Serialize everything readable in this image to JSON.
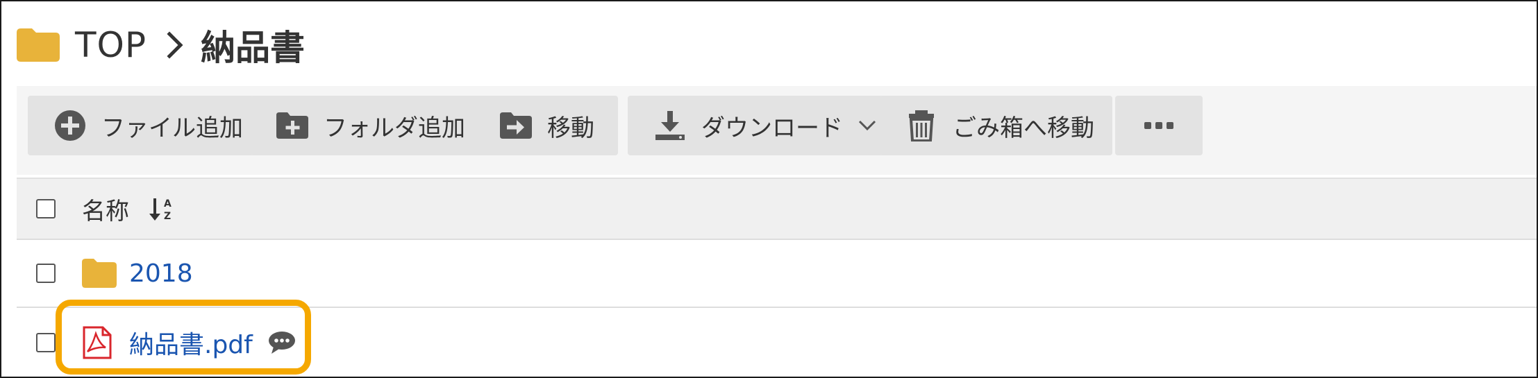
{
  "breadcrumb": {
    "root_label": "TOP",
    "separator_icon": "chevron-right-icon",
    "current_label": "納品書"
  },
  "toolbar": {
    "add_file_label": "ファイル追加",
    "add_folder_label": "フォルダ追加",
    "move_label": "移動",
    "download_label": "ダウンロード",
    "trash_label": "ごみ箱へ移動",
    "more_icon": "ellipsis-icon"
  },
  "table": {
    "header": {
      "name_label": "名称",
      "sort_icon": "sort-az-icon"
    },
    "rows": [
      {
        "type": "folder",
        "name": "2018",
        "icon": "folder-icon"
      },
      {
        "type": "pdf",
        "name": "納品書.pdf",
        "icon": "pdf-icon",
        "has_comment": true
      }
    ]
  },
  "colors": {
    "folder": "#e8b33a",
    "link": "#1a55b0",
    "pdf_red": "#d9262c",
    "highlight": "#f5a800",
    "button_bg": "#e3e3e3",
    "icon_dark": "#555555"
  }
}
